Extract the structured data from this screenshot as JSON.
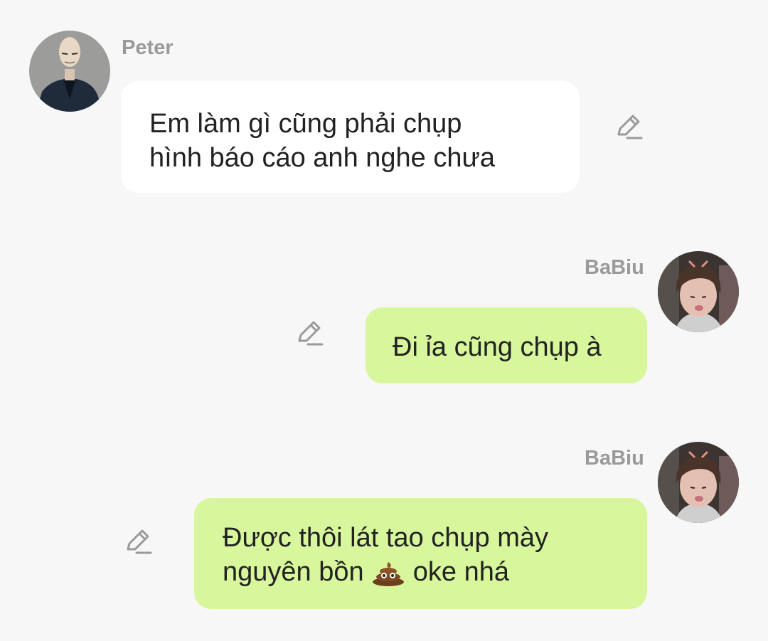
{
  "colors": {
    "background": "#f7f7f7",
    "incoming_bubble": "#ffffff",
    "outgoing_bubble": "#d8f79d",
    "sender_name": "#9a9a9a",
    "icon": "#9a9a9a"
  },
  "messages": [
    {
      "direction": "incoming",
      "sender": "Peter",
      "avatar_icon": "user-avatar-peter",
      "lines": [
        "Em làm gì cũng phải chụp",
        "hình báo cáo anh nghe chưa"
      ]
    },
    {
      "direction": "outgoing",
      "sender": "BaBiu",
      "avatar_icon": "user-avatar-babiu",
      "lines": [
        "Đi ỉa cũng chụp à"
      ]
    },
    {
      "direction": "outgoing",
      "sender": "BaBiu",
      "avatar_icon": "user-avatar-babiu",
      "lines": [
        "Được thôi lát tao chụp mày"
      ],
      "line2_before_emoji": "nguyên bồn ",
      "emoji_icon": "pile-of-poo-emoji",
      "line2_after_emoji": " oke nhá"
    }
  ],
  "edit_icon": "pencil-edit-icon"
}
